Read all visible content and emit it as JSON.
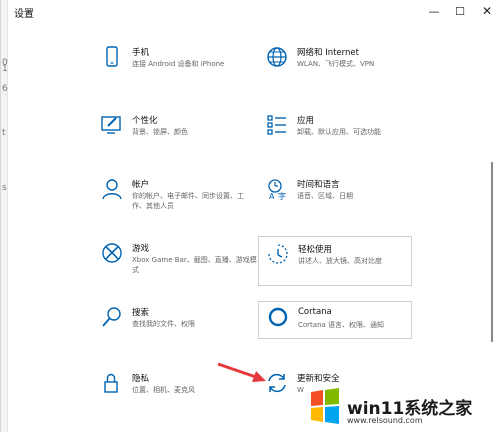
{
  "window": {
    "title": "设置",
    "minimize_glyph": "—",
    "maximize_glyph": "☐",
    "close_glyph": "✕"
  },
  "left_strip": [
    "0",
    "1",
    "6",
    "t",
    "s"
  ],
  "tiles": [
    {
      "icon": "phone-icon",
      "label": "手机",
      "desc": "连接 Android 设备和 iPhone"
    },
    {
      "icon": "globe-icon",
      "label": "网络和 Internet",
      "desc": "WLAN、飞行模式、VPN"
    },
    {
      "icon": "personalization-icon",
      "label": "个性化",
      "desc": "背景、锁屏、颜色"
    },
    {
      "icon": "apps-icon",
      "label": "应用",
      "desc": "卸载、默认应用、可选功能"
    },
    {
      "icon": "account-icon",
      "label": "帐户",
      "desc": "你的帐户、电子邮件、同步设置、工作、其他人员"
    },
    {
      "icon": "time-language-icon",
      "label": "时间和语言",
      "desc": "语音、区域、日期"
    },
    {
      "icon": "xbox-icon",
      "label": "游戏",
      "desc": "Xbox Game Bar、截图、直播、游戏模式"
    },
    {
      "icon": "ease-of-access-icon",
      "label": "轻松使用",
      "desc": "讲述人、放大镜、高对比度"
    },
    {
      "icon": "search-icon",
      "label": "搜索",
      "desc": "查找我的文件、权限"
    },
    {
      "icon": "cortana-icon",
      "label": "Cortana",
      "desc": "Cortana 语言、权限、通知"
    },
    {
      "icon": "lock-icon",
      "label": "隐私",
      "desc": "位置、相机、麦克风"
    },
    {
      "icon": "update-icon",
      "label": "更新和安全",
      "desc": "W"
    }
  ],
  "watermark": {
    "text": "win11系统之家",
    "sub": "www.relsound.com"
  },
  "colors": {
    "accent": "#0063b1",
    "arrow": "#e5393d"
  }
}
